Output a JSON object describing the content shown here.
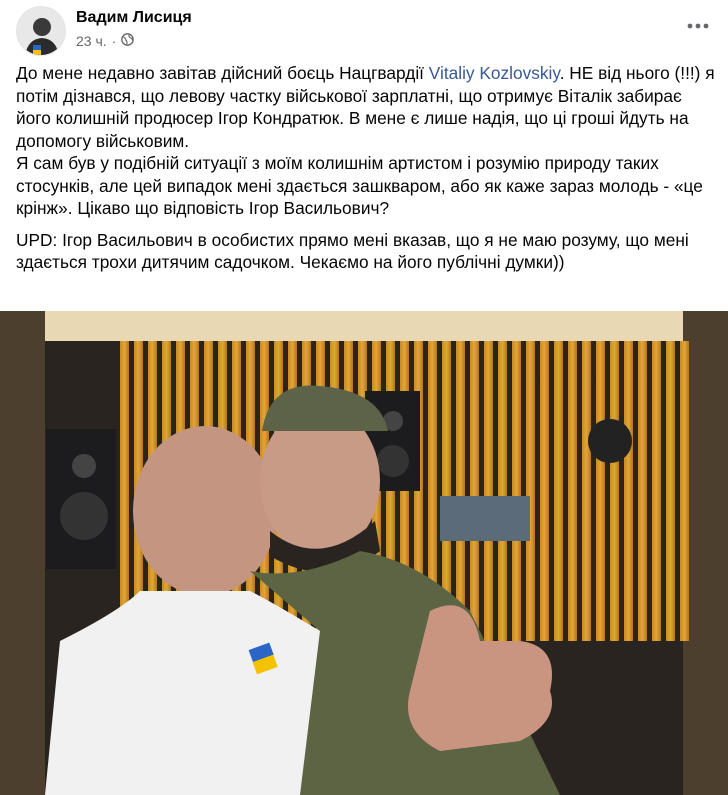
{
  "post": {
    "author": "Вадим Лисиця",
    "time": "23 ч.",
    "separator": "·",
    "text": {
      "p1_before": "До мене недавно завітав дійсний боєць Нацгвардії ",
      "p1_link": "Vitaliy Kozlovskiy",
      "p1_after": ". НЕ від нього (!!!) я потім дізнався, що левову частку військової зарплатні, що отримує Віталік забирає його колишній продюсер Ігор Кондратюк. В мене є лише надія, що ці гроші йдуть на допомогу військовим.",
      "p2": "Я сам був у подібній ситуації з моїм колишнім артистом і розумію природу таких стосунків, але цей випадок мені здається зашкваром, або як каже зараз молодь - «це крінж». Цікаво що відповість Ігор Васильович?",
      "p3": "UPD: Ігор Васильович в особистих прямо мені вказав, що я не маю розуму, що мені здається трохи дитячим садочком.  Чекаємо на його публічні думки))"
    }
  },
  "icons": {
    "globe": "globe-icon",
    "more": "more-options-icon"
  },
  "colors": {
    "link": "#385898",
    "meta": "#65676b",
    "text": "#050505"
  }
}
